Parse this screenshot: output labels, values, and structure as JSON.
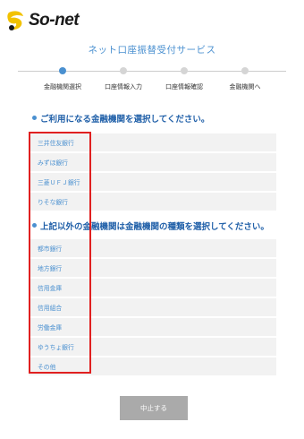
{
  "header": {
    "logo_text": "So-net",
    "service_title": "ネット口座振替受付サービス"
  },
  "steps": [
    {
      "label": "金融機関選択",
      "active": true
    },
    {
      "label": "口座情報入力",
      "active": false
    },
    {
      "label": "口座情報確認",
      "active": false
    },
    {
      "label": "金融機関へ",
      "active": false
    }
  ],
  "section1": {
    "heading": "ご利用になる金融機関を選択してください。",
    "items": [
      "三井住友銀行",
      "みずほ銀行",
      "三菱ＵＦＪ銀行",
      "りそな銀行"
    ]
  },
  "section2": {
    "heading": "上記以外の金融機関は金融機関の種類を選択してください。",
    "items": [
      "都市銀行",
      "地方銀行",
      "信用金庫",
      "信用組合",
      "労働金庫",
      "ゆうちょ銀行",
      "その他"
    ]
  },
  "footer": {
    "cancel_label": "中止する"
  },
  "colors": {
    "accent": "#4a90d0",
    "heading": "#1f5fa8",
    "highlight": "#e02020",
    "row_bg": "#f2f2f2",
    "button_bg": "#aaaaaa"
  }
}
